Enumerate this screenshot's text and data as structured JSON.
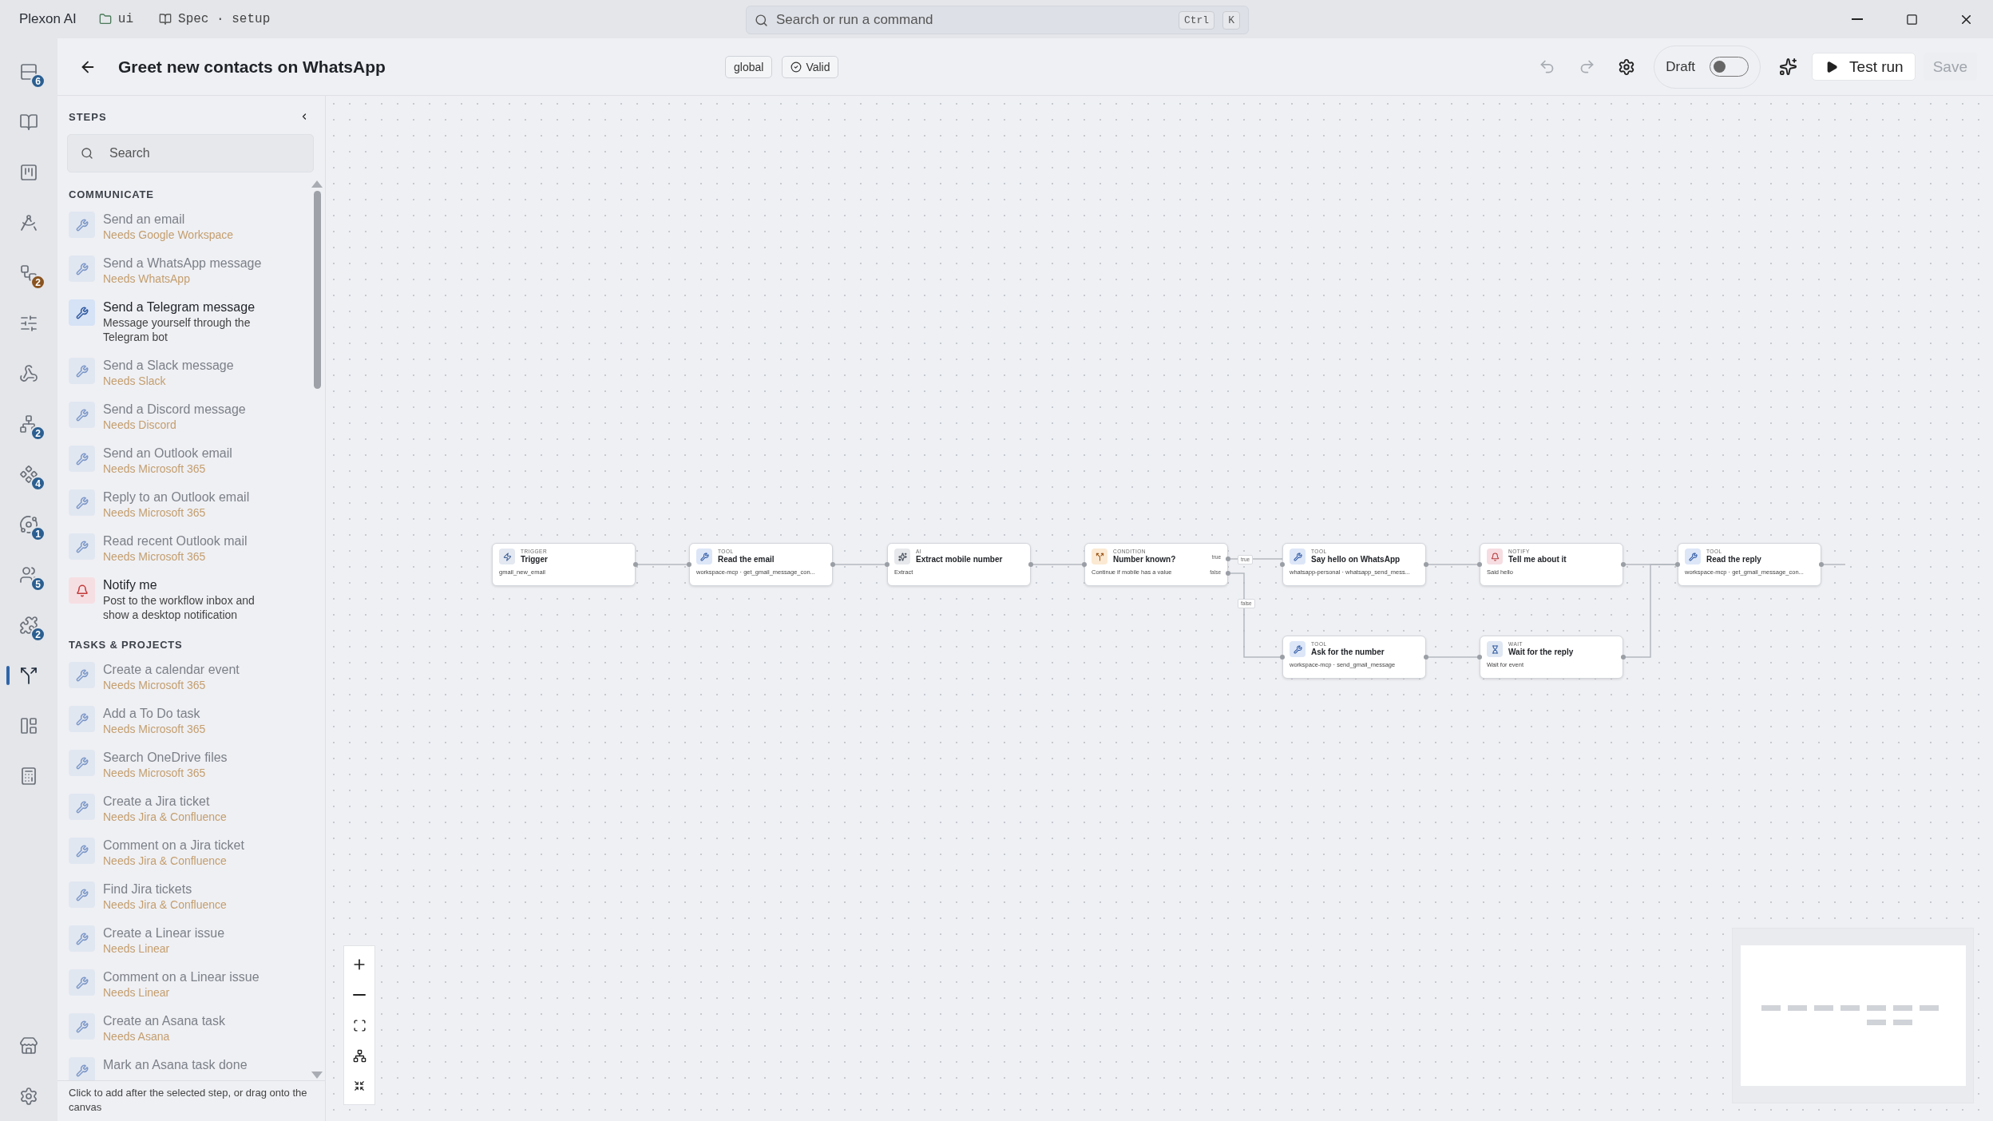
{
  "app": {
    "name": "Plexon AI",
    "folder": "ui",
    "spec": "Spec · setup",
    "search_placeholder": "Search or run a command",
    "shortcut": [
      "Ctrl",
      "K"
    ]
  },
  "rail": [
    {
      "badge": {
        "count": "6",
        "color": "#2b5f91"
      },
      "selected": false
    },
    {
      "selected": false
    },
    {
      "selected": false
    },
    {
      "selected": false
    },
    {
      "badge": {
        "count": "2",
        "color": "#8a5420"
      },
      "selected": false
    },
    {
      "selected": false
    },
    {
      "selected": false
    },
    {
      "badge": {
        "count": "2",
        "color": "#2b5f91"
      },
      "selected": false
    },
    {
      "badge": {
        "count": "4",
        "color": "#2b5f91"
      },
      "selected": false
    },
    {
      "badge": {
        "count": "1",
        "color": "#2b5f91"
      },
      "selected": false
    },
    {
      "badge": {
        "count": "5",
        "color": "#2b5f91"
      },
      "selected": false
    },
    {
      "badge": {
        "count": "2",
        "color": "#2b5f91"
      },
      "selected": false
    },
    {
      "selected": true
    },
    {
      "selected": false
    },
    {
      "selected": false
    }
  ],
  "rail_footer": [
    {
      "selected": false
    },
    {
      "selected": false
    }
  ],
  "header": {
    "title": "Greet new contacts on WhatsApp",
    "scope": "global",
    "status": "Valid",
    "undo_disabled": true,
    "redo_disabled": true,
    "draft": {
      "label": "Draft",
      "on": false
    },
    "test_run": "Test run",
    "save": {
      "label": "Save",
      "disabled": true
    }
  },
  "steps": {
    "title": "STEPS",
    "search_placeholder": "Search",
    "sections": [
      {
        "title": "COMMUNICATE",
        "items": [
          {
            "kind": "tool",
            "title": "Send an email",
            "subtitle": "Needs Google Workspace",
            "available": false
          },
          {
            "kind": "tool",
            "title": "Send a WhatsApp message",
            "subtitle": "Needs WhatsApp",
            "available": false
          },
          {
            "kind": "tool",
            "title": "Send a Telegram message",
            "subtitle": "Message yourself through the Telegram bot",
            "available": true
          },
          {
            "kind": "tool",
            "title": "Send a Slack message",
            "subtitle": "Needs Slack",
            "available": false
          },
          {
            "kind": "tool",
            "title": "Send a Discord message",
            "subtitle": "Needs Discord",
            "available": false
          },
          {
            "kind": "tool",
            "title": "Send an Outlook email",
            "subtitle": "Needs Microsoft 365",
            "available": false
          },
          {
            "kind": "tool",
            "title": "Reply to an Outlook email",
            "subtitle": "Needs Microsoft 365",
            "available": false
          },
          {
            "kind": "tool",
            "title": "Read recent Outlook mail",
            "subtitle": "Needs Microsoft 365",
            "available": false
          },
          {
            "kind": "notify",
            "title": "Notify me",
            "subtitle": "Post to the workflow inbox and show a desktop notification",
            "available": true
          }
        ]
      },
      {
        "title": "TASKS & PROJECTS",
        "items": [
          {
            "kind": "tool",
            "title": "Create a calendar event",
            "subtitle": "Needs Microsoft 365",
            "available": false
          },
          {
            "kind": "tool",
            "title": "Add a To Do task",
            "subtitle": "Needs Microsoft 365",
            "available": false
          },
          {
            "kind": "tool",
            "title": "Search OneDrive files",
            "subtitle": "Needs Microsoft 365",
            "available": false
          },
          {
            "kind": "tool",
            "title": "Create a Jira ticket",
            "subtitle": "Needs Jira & Confluence",
            "available": false
          },
          {
            "kind": "tool",
            "title": "Comment on a Jira ticket",
            "subtitle": "Needs Jira & Confluence",
            "available": false
          },
          {
            "kind": "tool",
            "title": "Find Jira tickets",
            "subtitle": "Needs Jira & Confluence",
            "available": false
          },
          {
            "kind": "tool",
            "title": "Create a Linear issue",
            "subtitle": "Needs Linear",
            "available": false
          },
          {
            "kind": "tool",
            "title": "Comment on a Linear issue",
            "subtitle": "Needs Linear",
            "available": false
          },
          {
            "kind": "tool",
            "title": "Create an Asana task",
            "subtitle": "Needs Asana",
            "available": false
          },
          {
            "kind": "tool",
            "title": "Mark an Asana task done",
            "available": false
          }
        ]
      }
    ],
    "hint": "Click to add after the selected step, or drag onto the canvas"
  },
  "canvas": {
    "nodes": [
      {
        "kind": "trigger",
        "type": "TRIGGER",
        "title": "Trigger",
        "subtitle": "gmail_new_email"
      },
      {
        "kind": "tool",
        "type": "TOOL",
        "title": "Read the email",
        "subtitle": "workspace-mcp · get_gmail_message_con..."
      },
      {
        "kind": "ai",
        "type": "AI",
        "title": "Extract mobile number",
        "subtitle": "Extract"
      },
      {
        "kind": "condition",
        "type": "CONDITION",
        "title": "Number known?",
        "subtitle": "Continue if mobile has a value",
        "outputs": [
          "true",
          "false"
        ]
      },
      {
        "kind": "tool",
        "type": "TOOL",
        "title": "Say hello on WhatsApp",
        "subtitle": "whatsapp-personal · whatsapp_send_mess..."
      },
      {
        "kind": "notify",
        "type": "NOTIFY",
        "title": "Tell me about it",
        "subtitle": "Said hello"
      },
      {
        "kind": "tool",
        "type": "TOOL",
        "title": "Read the reply",
        "subtitle": "workspace-mcp · get_gmail_message_con..."
      },
      {
        "kind": "tool",
        "type": "TOOL",
        "title": "Ask for the number",
        "subtitle": "workspace-mcp · send_gmail_message"
      },
      {
        "kind": "wait",
        "type": "WAIT",
        "title": "Wait for the reply",
        "subtitle": "Wait for event"
      }
    ],
    "edge_labels": [
      "true",
      "false"
    ]
  }
}
